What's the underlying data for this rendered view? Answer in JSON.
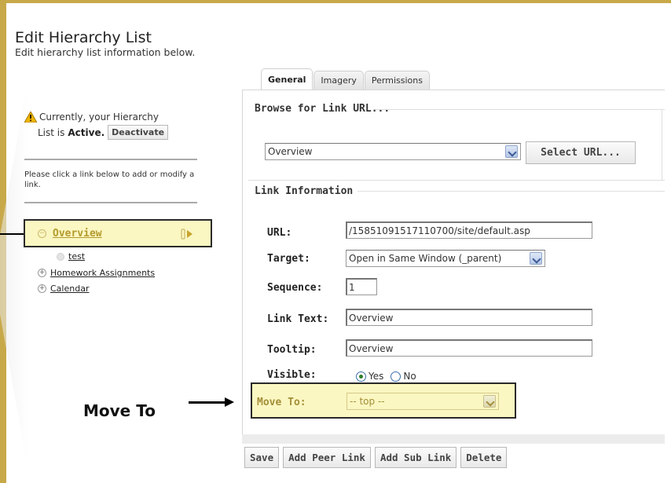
{
  "page": {
    "title": "Edit Hierarchy List",
    "subtitle": "Edit hierarchy list information below."
  },
  "sidebar": {
    "status_line1": "Currently, your Hierarchy",
    "status_prefix": "List is",
    "status_value": "Active.",
    "deactivate_label": "Deactivate",
    "help_text": "Please click a link below to add or modify a link.",
    "tree": {
      "selected": "Overview",
      "children": [
        "test"
      ],
      "siblings": [
        "Homework Assignments",
        "Calendar"
      ]
    }
  },
  "tabs": [
    {
      "label": "General",
      "active": true
    },
    {
      "label": "Imagery",
      "active": false
    },
    {
      "label": "Permissions",
      "active": false
    }
  ],
  "browse": {
    "title": "Browse for Link URL...",
    "selected": "Overview",
    "select_url_label": "Select URL..."
  },
  "link_info": {
    "title": "Link Information",
    "url_label": "URL:",
    "url_value": "/15851091517110700/site/default.asp",
    "target_label": "Target:",
    "target_value": "Open in Same Window (_parent)",
    "sequence_label": "Sequence:",
    "sequence_value": "1",
    "link_text_label": "Link Text:",
    "link_text_value": "Overview",
    "tooltip_label": "Tooltip:",
    "tooltip_value": "Overview",
    "visible_label": "Visible:",
    "visible_yes": "Yes",
    "visible_no": "No",
    "visible_value": "Yes",
    "move_to_label": "Move To:",
    "move_to_value": "-- top --"
  },
  "annotation": {
    "move_to": "Move To"
  },
  "actions": {
    "save": "Save",
    "add_peer": "Add Peer Link",
    "add_sub": "Add Sub Link",
    "delete": "Delete"
  },
  "colors": {
    "frame": "#c8a94a",
    "highlight": "#fbf7c2",
    "link_selected": "#b49a2d"
  }
}
